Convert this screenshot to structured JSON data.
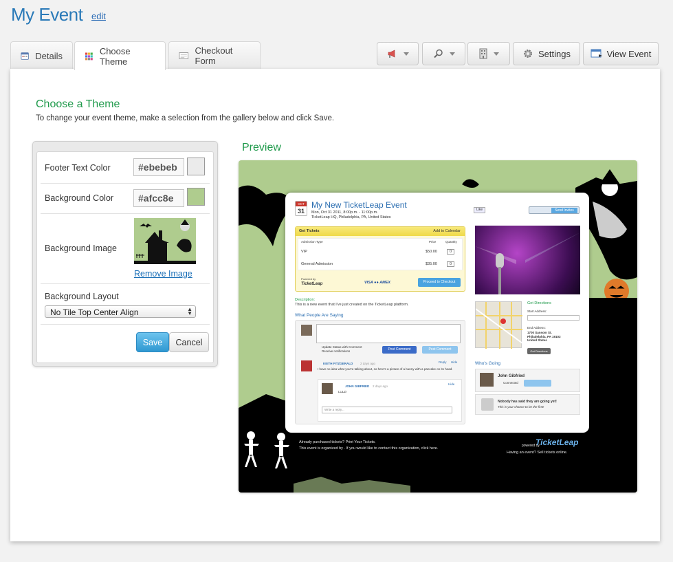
{
  "header": {
    "title": "My Event",
    "edit_label": "edit"
  },
  "tabs": [
    {
      "label": "Details"
    },
    {
      "label": "Choose Theme"
    },
    {
      "label": "Checkout Form"
    }
  ],
  "toolbar": {
    "settings_label": "Settings",
    "view_event_label": "View Event"
  },
  "section": {
    "title": "Choose a Theme",
    "intro": "To change your event theme, make a selection from the gallery below and click Save.",
    "preview_title": "Preview"
  },
  "form": {
    "footer_text_color_label": "Footer Text Color",
    "footer_text_color": "#ebebeb",
    "background_color_label": "Background Color",
    "background_color": "#afcc8e",
    "background_image_label": "Background Image",
    "remove_image_label": "Remove Image",
    "background_layout_label": "Background Layout",
    "background_layout_value": "No Tile Top Center Align",
    "save_label": "Save",
    "cancel_label": "Cancel"
  },
  "preview": {
    "cal_month": "OCT",
    "cal_day": "31",
    "event_title": "My New TicketLeap Event",
    "event_date": "Mon, Oct 31 2011, 8:00p.m. - 11:00p.m.",
    "event_location": "TicketLeap HQ, Philadelphia, PA, United States",
    "like_label": "Like",
    "send_invites_label": "Send Invites",
    "get_tickets": "Get Tickets",
    "add_to_calendar": "Add to Calendar",
    "col_admission": "Admission Type",
    "col_price": "Price",
    "col_quantity": "Quantity",
    "tickets": [
      {
        "type": "VIP",
        "price": "$50.00",
        "qty": "0"
      },
      {
        "type": "General Admission",
        "price": "$35.00",
        "qty": "0"
      }
    ],
    "powered_by": "Powered by",
    "ticketleap": "TicketLeap",
    "proceed_label": "Proceed to Checkout",
    "description_label": "Description:",
    "description": "This is a new event that I've just created on the TicketLeap platform.",
    "saying_title": "What People Are Saying",
    "update_status": "Update Status with Comment",
    "receive_notif": "Receive notifications",
    "post_comment": "Post Comment",
    "comment1_name": "KEITH FITZGERALD",
    "comment1_time": "2 days ago",
    "comment1_text": "I have no idea what you're talking about, so here's a picture of a bunny with a pancake on its head.",
    "reply_label": "Reply",
    "hide_label": "Hide",
    "comment2_name": "JOHN GIBFRIED",
    "comment2_time": "2 days ago",
    "comment2_text": "LULZ!",
    "write_reply": "Write a reply...",
    "get_directions": "Get Directions",
    "start_address": "Start Address:",
    "end_address": "End Address:",
    "end_address_value": "1700 Sansom St. Philadelphia, PA 19103 United States",
    "get_directions_btn": "Get Directions",
    "whos_going": "Who's Going",
    "going_name": "John Gibfried",
    "connected": "Connected",
    "nobody": "Nobody has said they are going yet!",
    "nobody_sub": "This is your chance to be the first!",
    "footer_line1": "Already purchased tickets? Print Your Tickets.",
    "footer_line2": "This event is organized by . If you would like to contact this organization, click here.",
    "footer_powered": "powered by",
    "footer_right": "Having an event? Sell tickets online."
  },
  "colors": {
    "brand_blue": "#2a7ab8",
    "heading_green": "#1f9a4b",
    "save_blue": "#3199d3",
    "preview_bg": "#afcc8e",
    "footer_text": "#ebebeb"
  },
  "icons": [
    "calendar-icon",
    "theme-grid-icon",
    "form-icon",
    "megaphone-icon",
    "search-icon",
    "building-icon",
    "gear-icon",
    "view-event-icon"
  ]
}
